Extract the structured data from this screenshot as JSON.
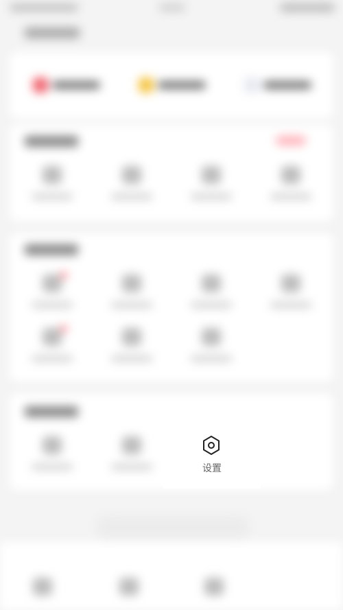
{
  "settings_label": "设置",
  "icons": {
    "settings": "hexagon-gear-icon"
  },
  "colors": {
    "background": "#f4f4f4",
    "card": "#ffffff",
    "badge": "#ff7a85",
    "accent_red": "#f2636f",
    "accent_yellow": "#f5c542"
  }
}
